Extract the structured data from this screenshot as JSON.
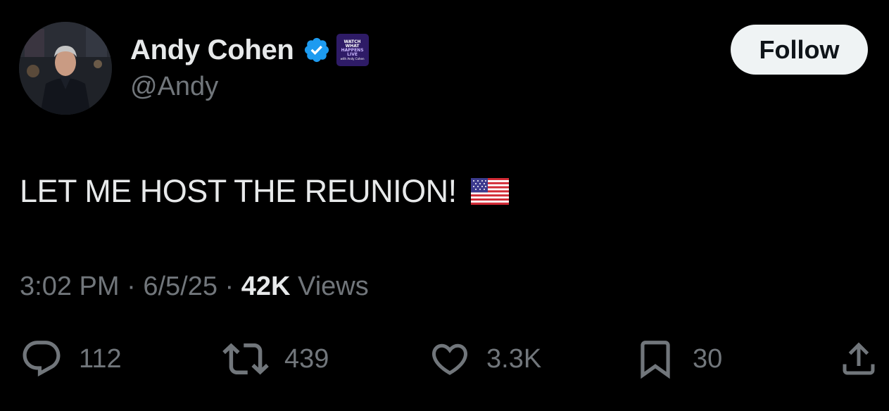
{
  "author": {
    "display_name": "Andy Cohen",
    "handle": "@Andy",
    "verified": true,
    "affiliate_badge": {
      "line1": "WATCH WHAT",
      "line2": "HAPPENS LIVE",
      "line3": "with Andy Cohen"
    }
  },
  "follow_label": "Follow",
  "tweet": {
    "text": "LET ME HOST THE REUNION!",
    "emoji": "us-flag"
  },
  "meta": {
    "time": "3:02 PM",
    "date": "6/5/25",
    "separator": "·",
    "views_count": "42K",
    "views_label": "Views"
  },
  "actions": {
    "replies": "112",
    "reposts": "439",
    "likes": "3.3K",
    "bookmarks": "30"
  },
  "colors": {
    "background": "#000000",
    "text_primary": "#e7e9ea",
    "text_secondary": "#71767b",
    "verified_blue": "#1d9bf0",
    "follow_bg": "#eff3f4"
  }
}
